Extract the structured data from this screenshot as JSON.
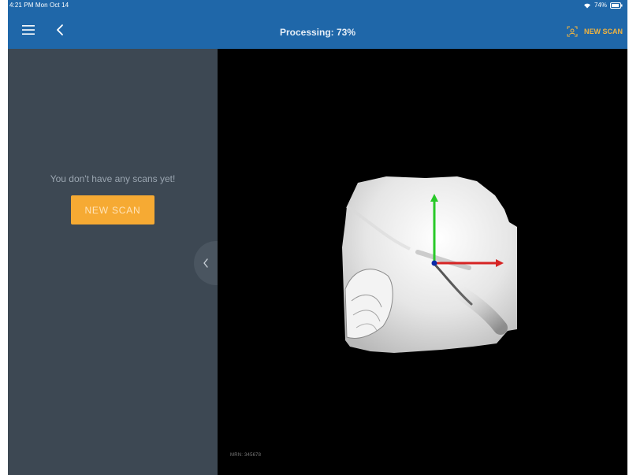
{
  "status_bar": {
    "time_date": "4:21 PM   Mon Oct 14",
    "battery": "74%"
  },
  "header": {
    "title": "Processing: 73%",
    "new_scan_label": "NEW SCAN",
    "icons": [
      "hamburger-menu-icon",
      "chevron-left-icon",
      "scan-icon"
    ]
  },
  "sidebar": {
    "empty_message": "You don't have any scans yet!",
    "new_scan_button": "NEW SCAN"
  },
  "viewer": {
    "mrn_label": "MRN: 345678",
    "axes_colors": {
      "x": "#d62424",
      "y": "#28c928",
      "origin": "#0b2aa8"
    }
  },
  "colors": {
    "header_bg": "#1f67a9",
    "sidebar_bg": "#3d4853",
    "accent": "#f6aa33",
    "viewer_bg": "#000000"
  }
}
